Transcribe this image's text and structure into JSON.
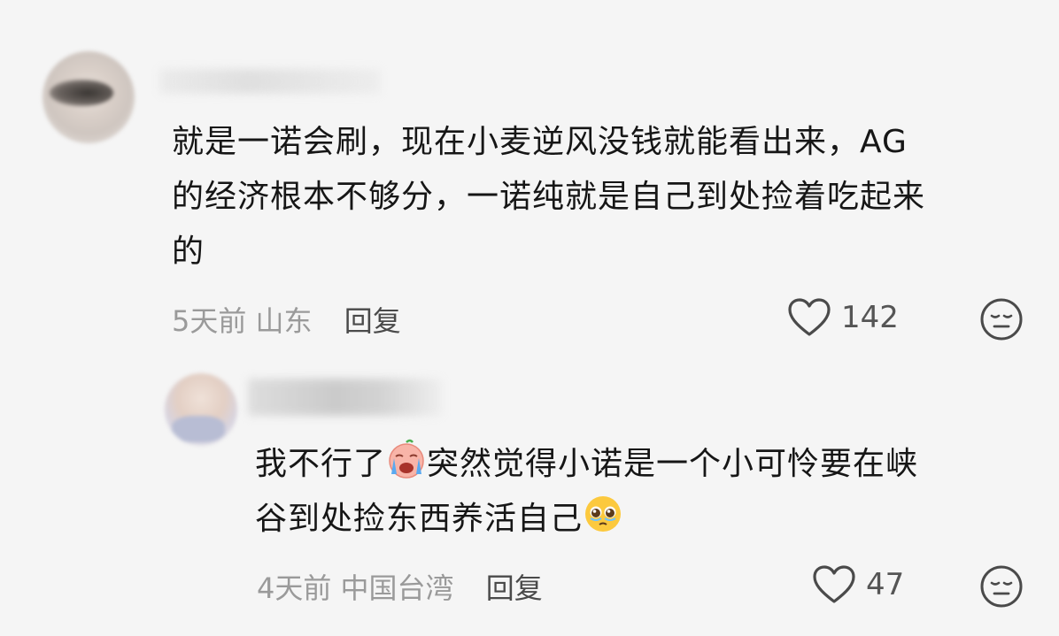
{
  "comments": [
    {
      "lines": [
        "就是一诺会刷，现在小麦逆风没钱就能看出来，AG",
        "的经济根本不够分，一诺纯就是自己到处捡着吃起来",
        "的"
      ],
      "time": "5天前",
      "location": "山东",
      "reply_label": "回复",
      "likes": "142"
    },
    {
      "line1_before": "我不行了",
      "line1_after": "突然觉得小诺是一个小可怜要在峡",
      "line2": "谷到处捡东西养活自己",
      "time": "4天前",
      "location": "中国台湾",
      "reply_label": "回复",
      "likes": "47"
    }
  ],
  "icons": {
    "like": "heart-outline-icon",
    "dislike": "meh-face-icon",
    "emoji_crying": "crying-face-emoji",
    "emoji_pleading": "pleading-face-emoji"
  }
}
